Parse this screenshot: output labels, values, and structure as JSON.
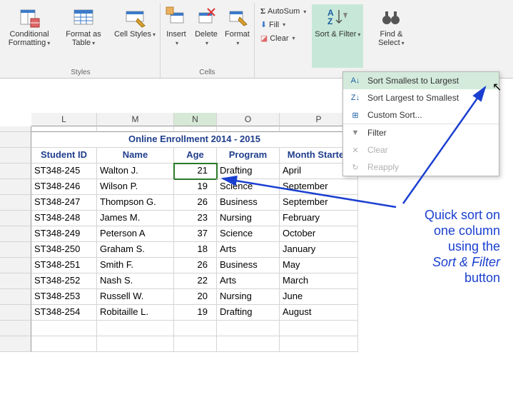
{
  "ribbon": {
    "styles": {
      "label": "Styles",
      "cond_fmt": "Conditional Formatting",
      "fmt_table": "Format as Table",
      "cell_styles": "Cell Styles"
    },
    "cells": {
      "label": "Cells",
      "insert": "Insert",
      "delete": "Delete",
      "format": "Format"
    },
    "editing": {
      "autosum": "AutoSum",
      "fill": "Fill",
      "clear": "Clear",
      "sort_filter": "Sort & Filter",
      "find_select": "Find & Select"
    }
  },
  "dropdown": {
    "sort_asc": "Sort Smallest to Largest",
    "sort_desc": "Sort Largest to Smallest",
    "custom": "Custom Sort...",
    "filter": "Filter",
    "clear": "Clear",
    "reapply": "Reapply"
  },
  "columns": [
    "L",
    "M",
    "N",
    "O",
    "P"
  ],
  "sheet": {
    "title": "Online Enrollment 2014 - 2015",
    "headers": {
      "student_id": "Student ID",
      "name": "Name",
      "age": "Age",
      "program": "Program",
      "month": "Month Started"
    },
    "rows": [
      {
        "id": "ST348-245",
        "name": "Walton J.",
        "age": "21",
        "program": "Drafting",
        "month": "April"
      },
      {
        "id": "ST348-246",
        "name": "Wilson P.",
        "age": "19",
        "program": "Science",
        "month": "September"
      },
      {
        "id": "ST348-247",
        "name": "Thompson G.",
        "age": "26",
        "program": "Business",
        "month": "September"
      },
      {
        "id": "ST348-248",
        "name": "James M.",
        "age": "23",
        "program": "Nursing",
        "month": "February"
      },
      {
        "id": "ST348-249",
        "name": "Peterson A",
        "age": "37",
        "program": "Science",
        "month": "October"
      },
      {
        "id": "ST348-250",
        "name": "Graham S.",
        "age": "18",
        "program": "Arts",
        "month": "January"
      },
      {
        "id": "ST348-251",
        "name": "Smith F.",
        "age": "26",
        "program": "Business",
        "month": "May"
      },
      {
        "id": "ST348-252",
        "name": "Nash S.",
        "age": "22",
        "program": "Arts",
        "month": "March"
      },
      {
        "id": "ST348-253",
        "name": "Russell W.",
        "age": "20",
        "program": "Nursing",
        "month": "June"
      },
      {
        "id": "ST348-254",
        "name": "Robitaille L.",
        "age": "19",
        "program": "Drafting",
        "month": "August"
      }
    ]
  },
  "annotation": {
    "line1": "Quick sort on",
    "line2": "one column",
    "line3": "using the",
    "line4_italic": "Sort & Filter",
    "line5": "button"
  }
}
